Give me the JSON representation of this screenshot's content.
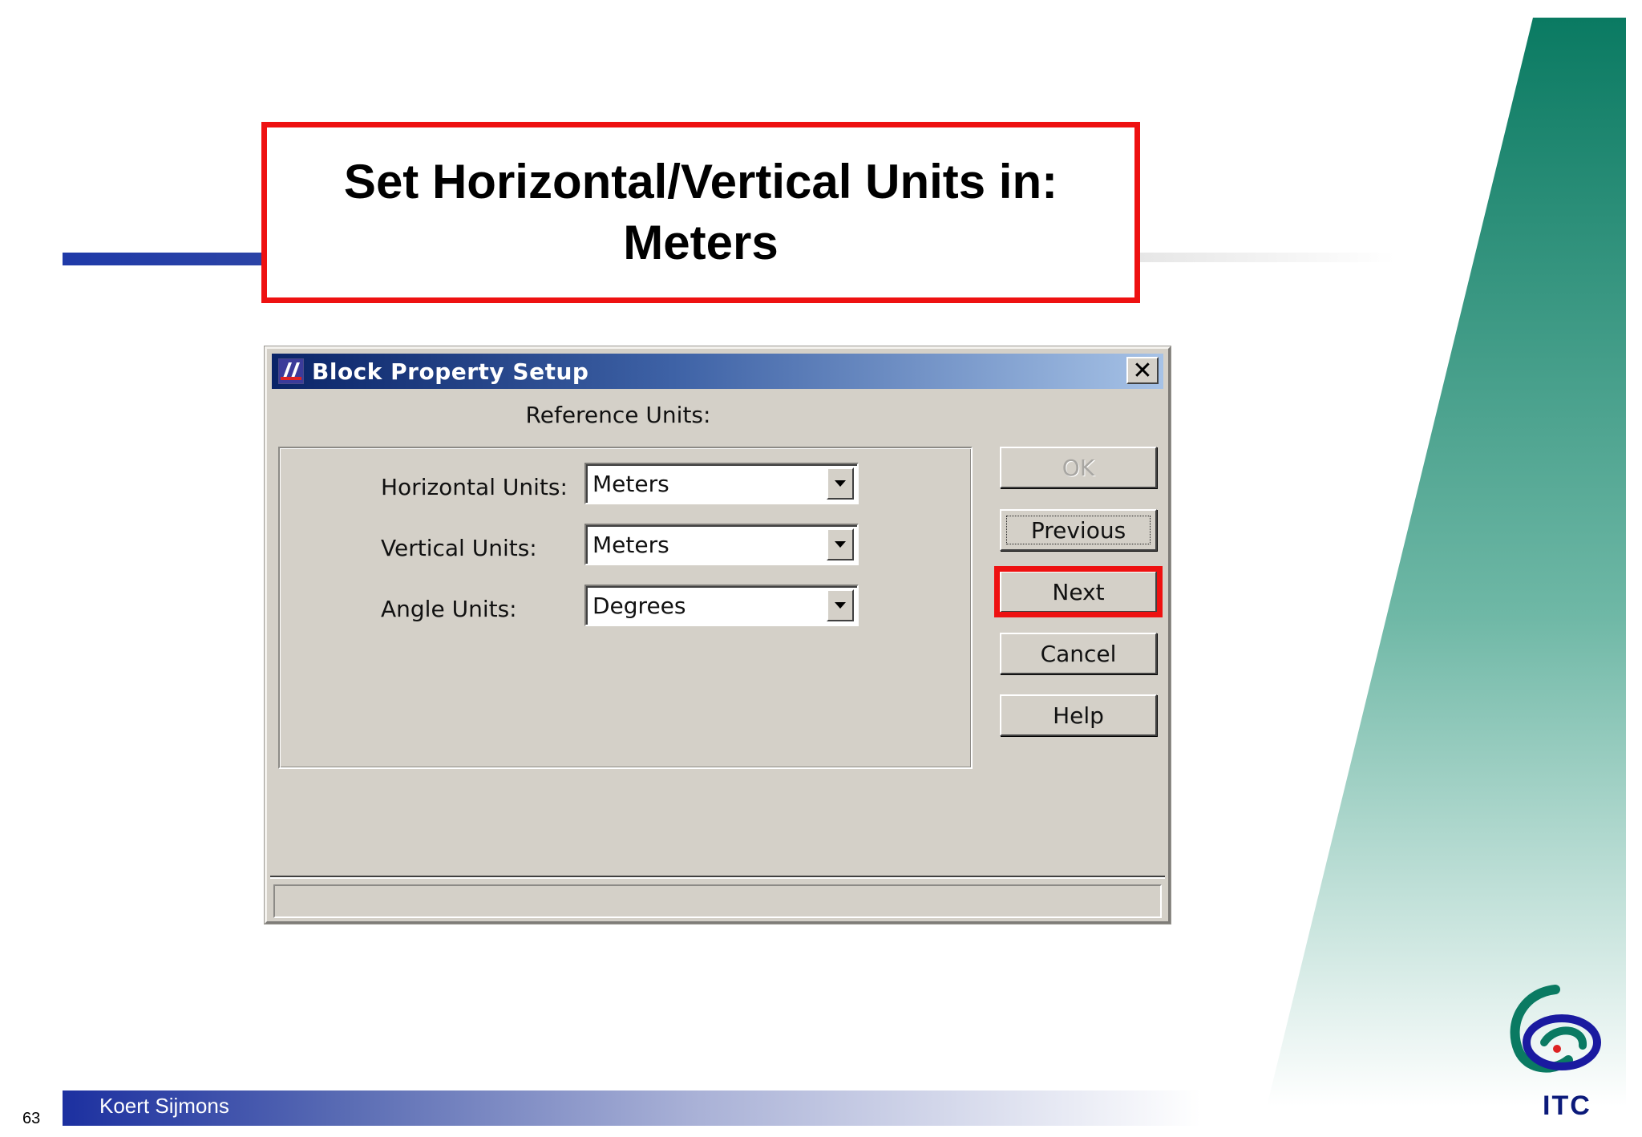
{
  "slide": {
    "title_line1": "Set Horizontal/Vertical Units in:",
    "title_line2": "Meters",
    "author": "Koert Sijmons",
    "page_number": "63",
    "logo_text": "ITC"
  },
  "dialog": {
    "title": "Block Property Setup",
    "close_symbol": "✕",
    "section_label": "Reference Units:",
    "fields": [
      {
        "label": "Horizontal Units:",
        "value": "Meters"
      },
      {
        "label": "Vertical Units:",
        "value": "Meters"
      },
      {
        "label": "Angle Units:",
        "value": "Degrees"
      }
    ],
    "buttons": {
      "ok": "OK",
      "previous": "Previous",
      "next": "Next",
      "cancel": "Cancel",
      "help": "Help"
    }
  },
  "colors": {
    "highlight": "#ee1111",
    "accent_blue": "#1f3aa8",
    "brand_green": "#0a7a62"
  }
}
